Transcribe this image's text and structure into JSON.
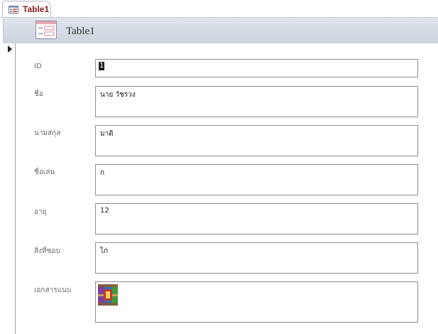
{
  "tab": {
    "label": "Table1",
    "icon": "form-icon"
  },
  "form": {
    "title": "Table1",
    "icon": "form-icon"
  },
  "record_selector": {
    "icon": "record-pointer-icon"
  },
  "fields": [
    {
      "label": "ID",
      "value": "1"
    },
    {
      "label": "ชื่อ",
      "value": "นาย วัชรวง"
    },
    {
      "label": "นามสกุล",
      "value": "มาดิ"
    },
    {
      "label": "ชื่อเล่น",
      "value": "ก"
    },
    {
      "label": "อายุ",
      "value": "12"
    },
    {
      "label": "สิ่งที่ชอบ",
      "value": "ไก่"
    },
    {
      "label": "เอกสารแนบ",
      "value": "",
      "icon": "winrar-archive-icon"
    }
  ],
  "colors": {
    "tab_text": "#8b1a1a",
    "header_bg": "#d8dee6",
    "border": "#8f8f8f"
  }
}
